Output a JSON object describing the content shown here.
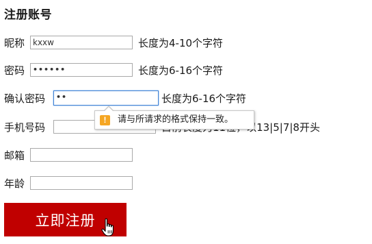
{
  "page": {
    "title": "注册账号"
  },
  "form": {
    "nickname": {
      "label": "昵称",
      "value": "kxxw",
      "hint": "长度为4-10个字符"
    },
    "password": {
      "label": "密码",
      "value": "••••••",
      "hint": "长度为6-16个字符"
    },
    "confirm_password": {
      "label": "确认密码",
      "value": "••",
      "hint": "长度为6-16个字符"
    },
    "phone": {
      "label": "手机号码",
      "value": "",
      "hint": "目前长度为11位，以13|5|7|8开头"
    },
    "email": {
      "label": "邮箱",
      "value": ""
    },
    "age": {
      "label": "年龄",
      "value": ""
    },
    "submit_label": "立即注册"
  },
  "validation_tooltip": {
    "icon": "warning-icon",
    "icon_glyph": "!",
    "message": "请与所请求的格式保持一致。"
  },
  "colors": {
    "submit_background": "#c00000",
    "submit_text": "#ffffff",
    "warning_icon": "#f5a623",
    "focus_border": "#3b7fd4"
  }
}
